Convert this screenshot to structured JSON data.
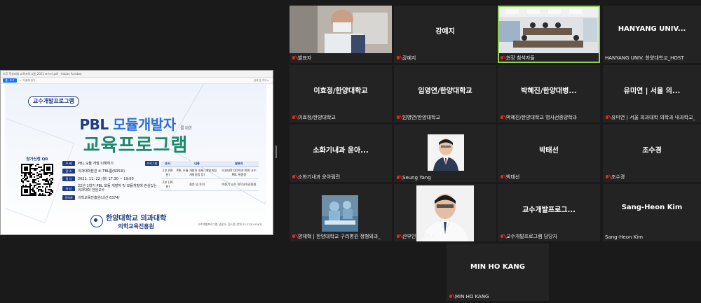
{
  "shared_screen": {
    "window_title": "오후 학술대회 교육프로그램_2021 포스터.pdf - Adobe Acrobat",
    "toolbar_button": "홈 · 도구",
    "toolbar_label": "← 다음에 찾기",
    "toolbar_right": "검색 및 주석 ▾",
    "poster": {
      "tag": "교수개발프로그램",
      "title_a": "PBL",
      "title_b": "모듈개발자",
      "title_small": "를 위한",
      "subtitle": "교육프로그램",
      "qr_label": "참가신청 QR",
      "info": [
        {
          "label": "주 제",
          "value": "PBL 모듈 개발 이해하기"
        },
        {
          "label": "장 소",
          "value": "의과대학본관 ⑥ TBL룸(605호)"
        },
        {
          "label": "일 시",
          "value": "2021. 11. 22 (월) 17:30 ~ 19:00"
        },
        {
          "label": "대 상",
          "value": "22년 1학기 PBL 모듈 개발자 및 모듈개발에 관심있는 의과대학 전임교수"
        },
        {
          "label": "문의처",
          "value": "의학교육진흥원(내선 6374)"
        }
      ],
      "program_label": "프로그램",
      "program_headers": [
        "순서",
        "내용",
        "발표자"
      ],
      "program_rows": [
        {
          "order": "1부 (60분)",
          "content": "PBL 모듈 개발의 실제 (개발과정, 개발방법 등)",
          "speaker": "의과대학 OO학과 000 교수 PBL 위원장"
        },
        {
          "order": "2부 (30분)",
          "content": "질문 및 토의",
          "speaker": "박종기 교수 의학교육진흥원"
        }
      ],
      "logo_line1": "한양대학교 의과대학",
      "logo_line2": "의학교육진흥원",
      "footnote": "교수개발프로그램 담당자: 김소정 (문의 02.2220.0367)"
    }
  },
  "tiles": [
    {
      "id": "presenter",
      "name": "",
      "caption": "발표자",
      "video": "presenter"
    },
    {
      "id": "kang",
      "name": "강예지",
      "caption": "강예지"
    },
    {
      "id": "room",
      "name": "",
      "caption": "현장 참석자들",
      "video": "room",
      "active": true
    },
    {
      "id": "host",
      "name": "HANYANG UNIV...",
      "caption": "HANYANG UNIV. 한양대학교_HOST"
    },
    {
      "id": "lee",
      "name": "이효정/한양대학교",
      "caption": "이효정/한양대학교"
    },
    {
      "id": "lim",
      "name": "임영연/한양대학교",
      "caption": "임영연/한양대학교"
    },
    {
      "id": "park",
      "name": "박혜진/한양대병...",
      "caption": "박혜진/한양대학교 명사선종양학과"
    },
    {
      "id": "yoo",
      "name": "유미연 | 서울 의...",
      "caption": "유미연 | 서울 의과대학 의학과 내과학교_"
    },
    {
      "id": "soh",
      "name": "소화기내과 윤아...",
      "caption": "소화기내과 윤아림린"
    },
    {
      "id": "seung",
      "name": "",
      "caption": "Seung Yang",
      "video": "portrait"
    },
    {
      "id": "parkts",
      "name": "박태선",
      "caption": "박태선"
    },
    {
      "id": "jo",
      "name": "조수경",
      "caption": "조수경"
    },
    {
      "id": "yang",
      "name": "",
      "caption": "양재혁 | 한양대학교 구리병원 정형외과_",
      "video": "surgery"
    },
    {
      "id": "sanbu",
      "name": "",
      "caption": "산부인과 정진석",
      "video": "portrait2"
    },
    {
      "id": "faculty",
      "name": "교수개발프로그...",
      "caption": "교수개발프로그램 담당자"
    },
    {
      "id": "sangheon",
      "name": "Sang-Heon Kim",
      "caption": "Sang-Heon Kim"
    },
    {
      "id": "minho",
      "name": "MIN HO KANG",
      "caption": "MIN HO KANG"
    }
  ]
}
